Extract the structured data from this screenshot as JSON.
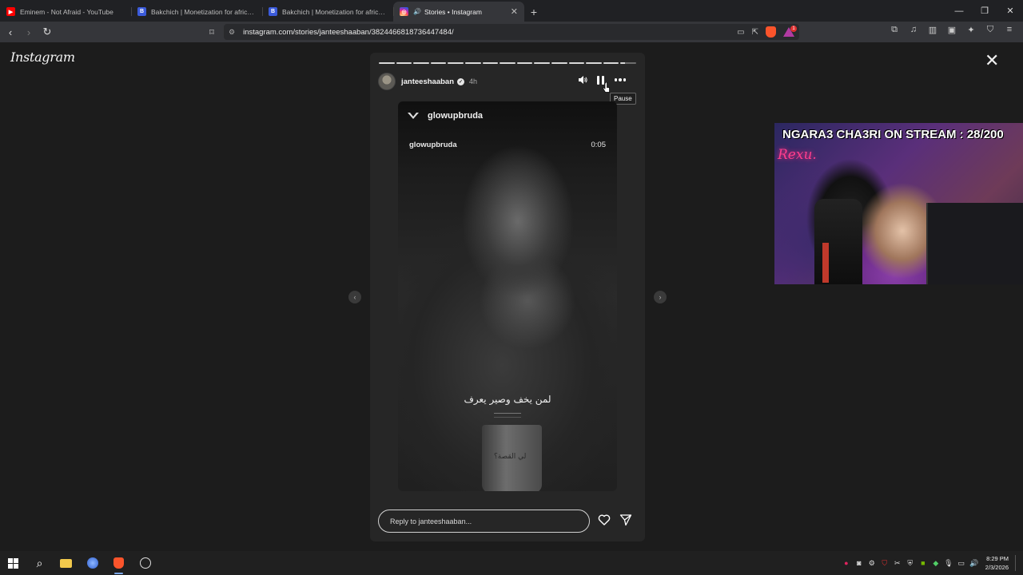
{
  "browser": {
    "tabs": [
      {
        "title": "Eminem - Not Afraid - YouTube",
        "favicon": "youtube-icon",
        "color": "#ff0000",
        "active": false
      },
      {
        "title": "Bakchich | Monetization for african cr",
        "favicon": "bakchich-icon",
        "color": "#3b5bdb",
        "active": false
      },
      {
        "title": "Bakchich | Monetization for african cr",
        "favicon": "bakchich-icon",
        "color": "#3b5bdb",
        "active": false
      },
      {
        "title": "Stories • Instagram",
        "favicon": "instagram-icon",
        "color": "#d6249f",
        "active": true,
        "audio": true
      }
    ],
    "url": "instagram.com/stories/janteeshaaban/3824466818736447484/",
    "shields_badge": "1"
  },
  "instagram": {
    "logo": "Instagram",
    "story": {
      "progress_segments": 15,
      "username": "janteeshaaban",
      "time_ago": "4h",
      "tooltip": "Pause",
      "video": {
        "account": "glowupbruda",
        "subtitle_account": "glowupbruda",
        "timestamp": "0:05",
        "arabic_caption": "لمن يخف وصير يعرف",
        "mug_text": "لي القصة؟"
      },
      "reply_placeholder": "Reply to janteeshaaban..."
    }
  },
  "stream_overlay": {
    "headline": "NGARA3 CHA3RI ON STREAM : 28/200",
    "neon_sign": "Rexu."
  },
  "taskbar": {
    "time": "8:29 PM",
    "date": "2/3/2026"
  }
}
